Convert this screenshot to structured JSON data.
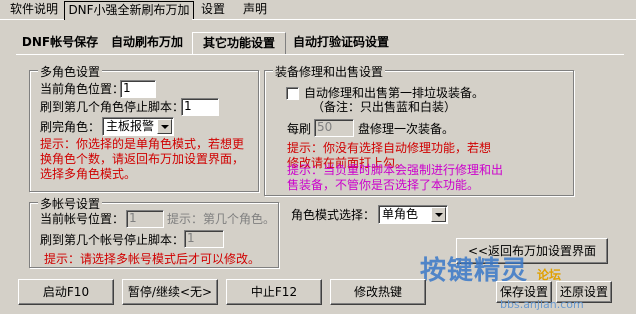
{
  "top_tabs": [
    "软件说明",
    "DNF小强全新刷布万加",
    "设置",
    "声明"
  ],
  "sub_tabs": [
    "DNF帐号保存",
    "自动刷布万加",
    "其它功能设置",
    "自动打验证码设置"
  ],
  "multi_role": {
    "legend": "多角色设置",
    "current_pos_label": "当前角色位置：",
    "current_pos_value": "1",
    "stop_label": "刷到第几个角色停止脚本：",
    "stop_value": "1",
    "done_label": "刷完角色：",
    "done_select": "主板报警",
    "hint": "提示：你选择的是单角色模式，若想更换角色个数，请返回布万加设置界面，选择多角色模式。"
  },
  "multi_account": {
    "legend": "多帐号设置",
    "current_label": "当前帐号位置：",
    "current_value": "1",
    "current_hint": "提示：第几个角色。",
    "stop_label": "刷到第几个帐号停止脚本：",
    "stop_value": "1",
    "hint": "提示：请选择多帐号模式后才可以修改。"
  },
  "repair": {
    "legend": "装备修理和出售设置",
    "checkbox_label": "自动修理和出售第一排垃圾装备。",
    "note": "（备注：只出售蓝和白装）",
    "every_label": "每刷",
    "every_value": "50",
    "every_suffix": "盘修理一次装备。",
    "hint_red": "提示：你没有选择自动修理功能，若想修改请在前面打上勾。",
    "hint_magenta": "提示：当负重时脚本会强制进行修理和出售装备，不管你是否选择了本功能。"
  },
  "role_mode": {
    "label": "角色模式选择：",
    "value": "单角色"
  },
  "buttons": {
    "back": "<<返回布万加设置界面",
    "start": "启动F10",
    "pause": "暂停/继续<无>",
    "stop": "中止F12",
    "hotkey": "修改热键",
    "save": "保存设置",
    "restore": "还原设置"
  },
  "watermark": {
    "main": "按键精灵",
    "tag": "论坛",
    "url": "bbs.anjian.com"
  }
}
